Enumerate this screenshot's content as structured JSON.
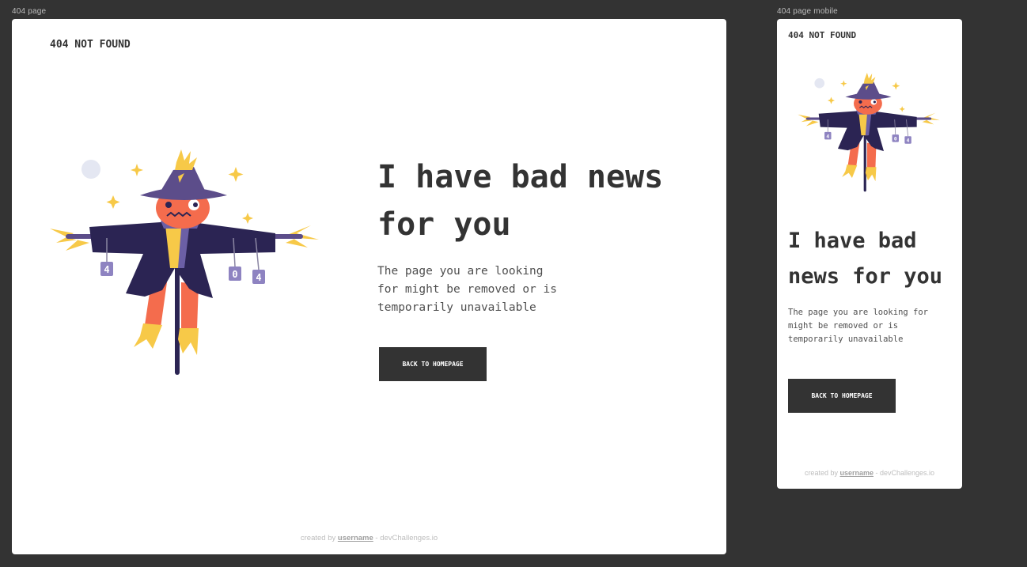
{
  "colors": {
    "canvas": "#333333",
    "card": "#ffffff",
    "text_dark": "#333333",
    "button_bg": "#333333",
    "button_text": "#ffffff",
    "footer_text": "#bdbdbd",
    "hat": "#5c4d8a",
    "coat": "#2b2453",
    "head": "#f46c4d",
    "straw": "#f7c948",
    "scarf": "#6b5fa6"
  },
  "desktop": {
    "frame_label": "404 page",
    "logo": "404 NOT FOUND",
    "headline_line1": "I have bad news",
    "headline_line2": "for you",
    "body_line1": "The page you are looking",
    "body_line2": "for might be removed or is",
    "body_line3": "temporarily unavailable",
    "button_label": "BACK TO HOMEPAGE",
    "footer_prefix": "created by ",
    "footer_user": "username",
    "footer_suffix": " - devChallenges.io",
    "illustration": "scarecrow-illustration"
  },
  "mobile": {
    "frame_label": "404 page mobile",
    "logo": "404 NOT FOUND",
    "headline_line1": "I have bad",
    "headline_line2": "news for you",
    "body_line1": "The page you are looking for",
    "body_line2": "might be removed or is",
    "body_line3": "temporarily unavailable",
    "button_label": "BACK TO HOMEPAGE",
    "footer_prefix": "created by ",
    "footer_user": "username",
    "footer_suffix": " - devChallenges.io",
    "illustration": "scarecrow-illustration"
  }
}
